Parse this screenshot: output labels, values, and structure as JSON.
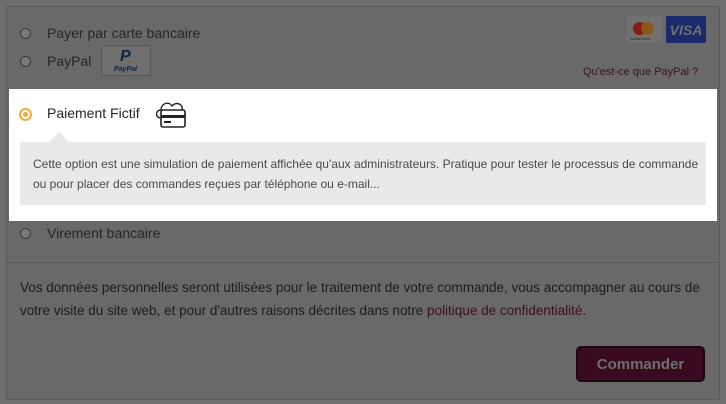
{
  "payment_methods": [
    {
      "label": "Payer par carte bancaire",
      "selected": false
    },
    {
      "label": "PayPal",
      "selected": false
    },
    {
      "label": "Paiement Fictif",
      "selected": true
    },
    {
      "label": "Virement bancaire",
      "selected": false
    }
  ],
  "card_logos": {
    "mastercard_text": "mastercard",
    "visa_text": "VISA"
  },
  "paypal": {
    "logo_text": "PayPal",
    "logo_letter": "P",
    "link": "Qu'est-ce que PayPal ?"
  },
  "fictif_description": "Cette option est une simulation de paiement affichée qu'aux administrateurs. Pratique pour tester le processus de commande ou pour placer des commandes reçues par téléphone ou e-mail...",
  "privacy": {
    "text": "Vos données personnelles seront utilisées pour le traitement de votre commande, vous accompagner au cours de votre visite du site web, et pour d'autres raisons décrites dans notre ",
    "link": "politique de confidentialité",
    "end": "."
  },
  "submit_label": "Commander",
  "colors": {
    "accent": "#f2ac3c",
    "brand": "#3a0a21"
  },
  "icons": [
    "cloud-card-icon",
    "mastercard-logo",
    "visa-logo",
    "paypal-logo"
  ]
}
